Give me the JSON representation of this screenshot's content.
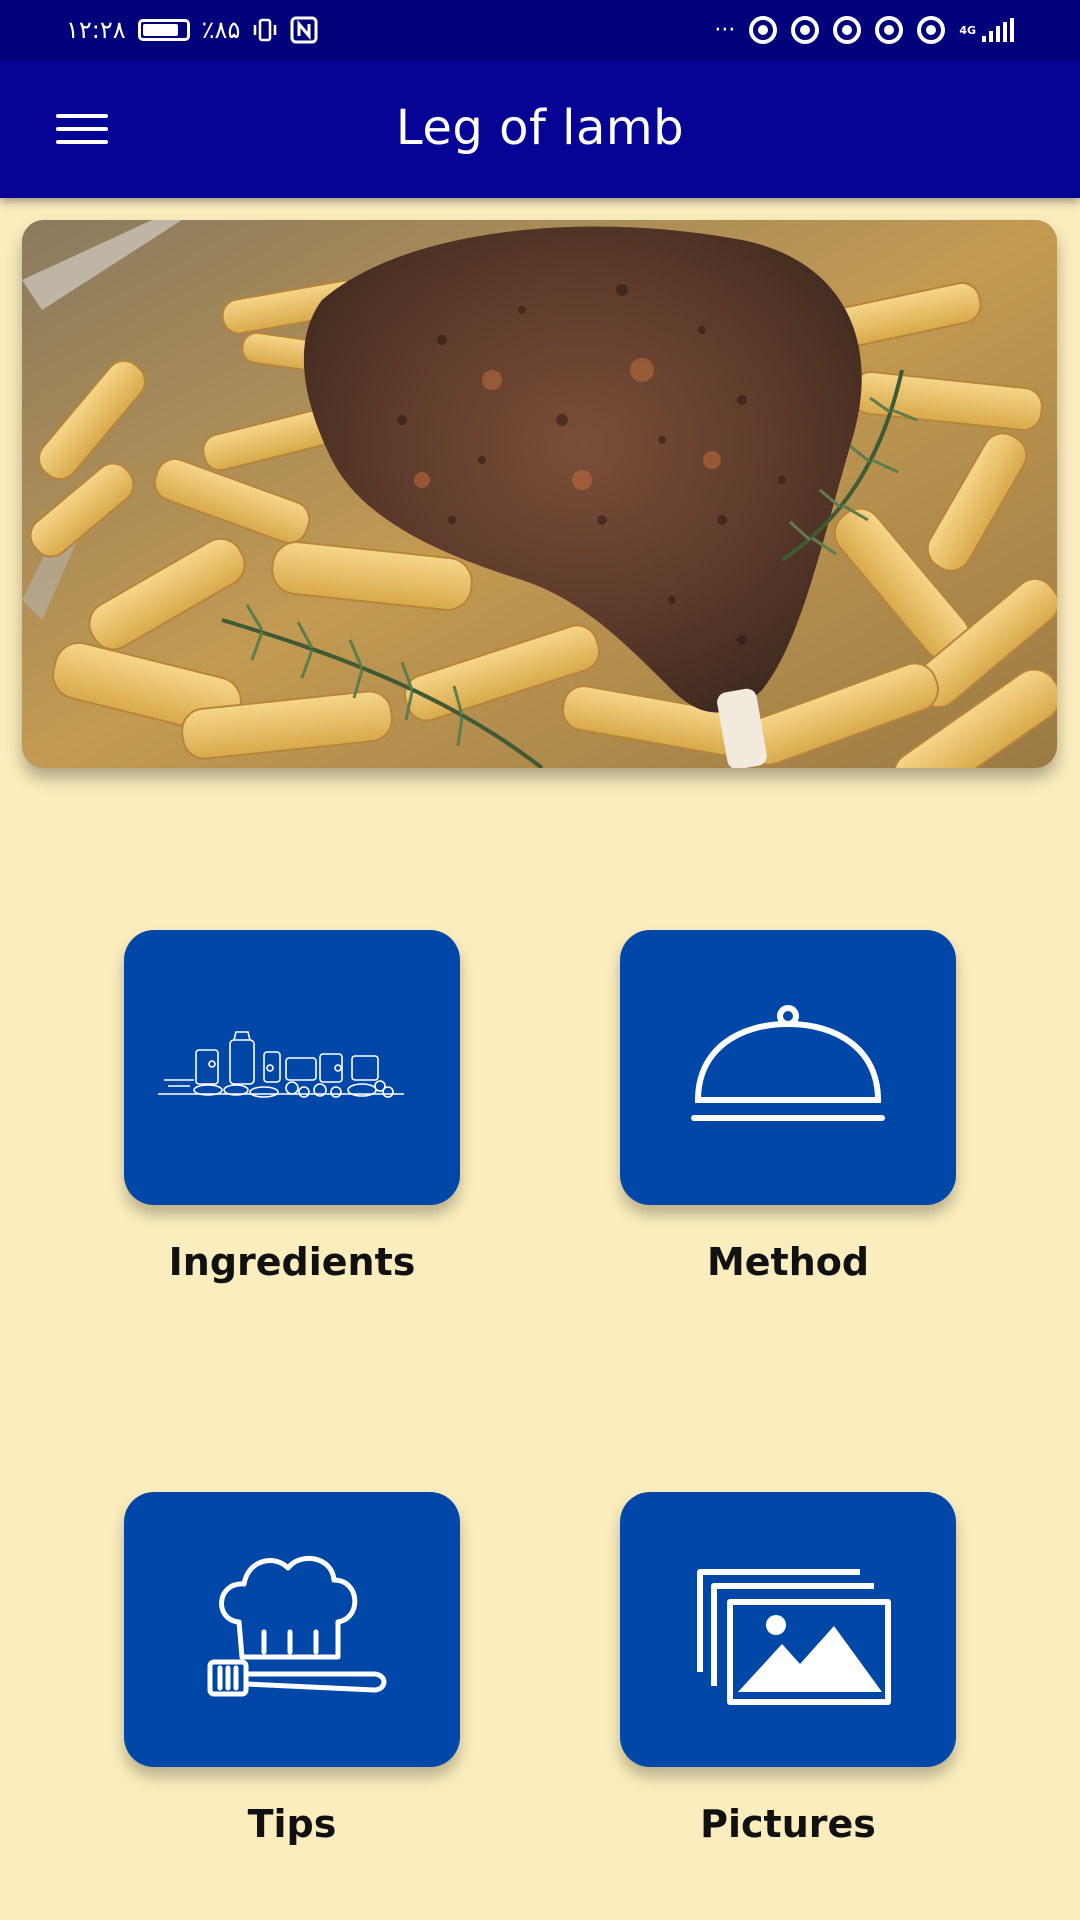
{
  "status_bar": {
    "time": "۱۲:۲۸",
    "battery": "٪۸۵",
    "more": "···",
    "network": "4G",
    "battery_level": 0.85
  },
  "app_bar": {
    "title": "Leg of lamb",
    "menu_icon": "hamburger-menu-icon"
  },
  "hero": {
    "description_icon": "roast-leg-of-lamb-photo"
  },
  "tiles": [
    {
      "label": "Ingredients",
      "icon": "ingredients-icon"
    },
    {
      "label": "Method",
      "icon": "serving-cloche-icon"
    },
    {
      "label": "Tips",
      "icon": "chef-hat-spatula-icon"
    },
    {
      "label": "Pictures",
      "icon": "gallery-icon"
    }
  ],
  "colors": {
    "background": "#fbedbd",
    "app_bar": "#050494",
    "status_bar": "#02037a",
    "tile": "#0147a8"
  }
}
